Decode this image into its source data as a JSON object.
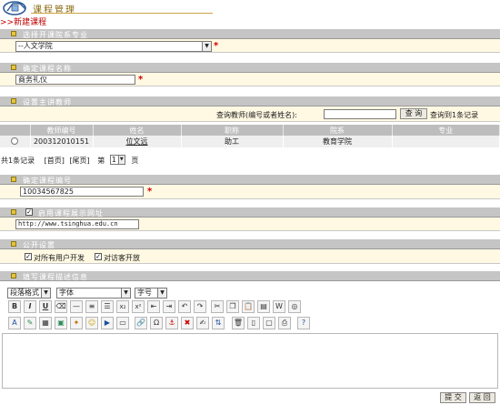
{
  "header": {
    "app_title": "课程管理",
    "page_title": ">>新建课程"
  },
  "sections": {
    "dept": "选择开课院系专业",
    "course_name": "确定课程名称",
    "teacher": "设置主讲教师",
    "course_code": "确定课程编号",
    "url": "启用课程展示网址",
    "public": "公开设置",
    "desc": "填写课程描述信息"
  },
  "dept_select": {
    "value": "--人文学院"
  },
  "course_name_value": "商务礼仪",
  "teacher_search": {
    "label": "查询教师(编号或者姓名):",
    "value": "",
    "button": "查 询",
    "result": "查询到1条记录"
  },
  "table": {
    "headers": [
      "教师编号",
      "姓名",
      "职称",
      "院系",
      "专业"
    ],
    "rows": [
      {
        "id": "200312010151",
        "name": "位文远",
        "title": "助工",
        "dept": "教育学院",
        "major": ""
      }
    ]
  },
  "pager": {
    "total": "共1条记录",
    "first": "[首页]",
    "last": "[尾页]",
    "page_prefix": "第",
    "page_value": "1",
    "page_suffix": "页"
  },
  "course_code_value": "10034567825",
  "url_value": "http://www.tsinghua.edu.cn",
  "public": {
    "opt1": "对所有用户开发",
    "opt2": "对访客开放"
  },
  "editor": {
    "format": "段落格式",
    "font": "字体",
    "size": "字号"
  },
  "required_mark": "*",
  "actions": {
    "submit": "提 交",
    "back": "返 回"
  }
}
